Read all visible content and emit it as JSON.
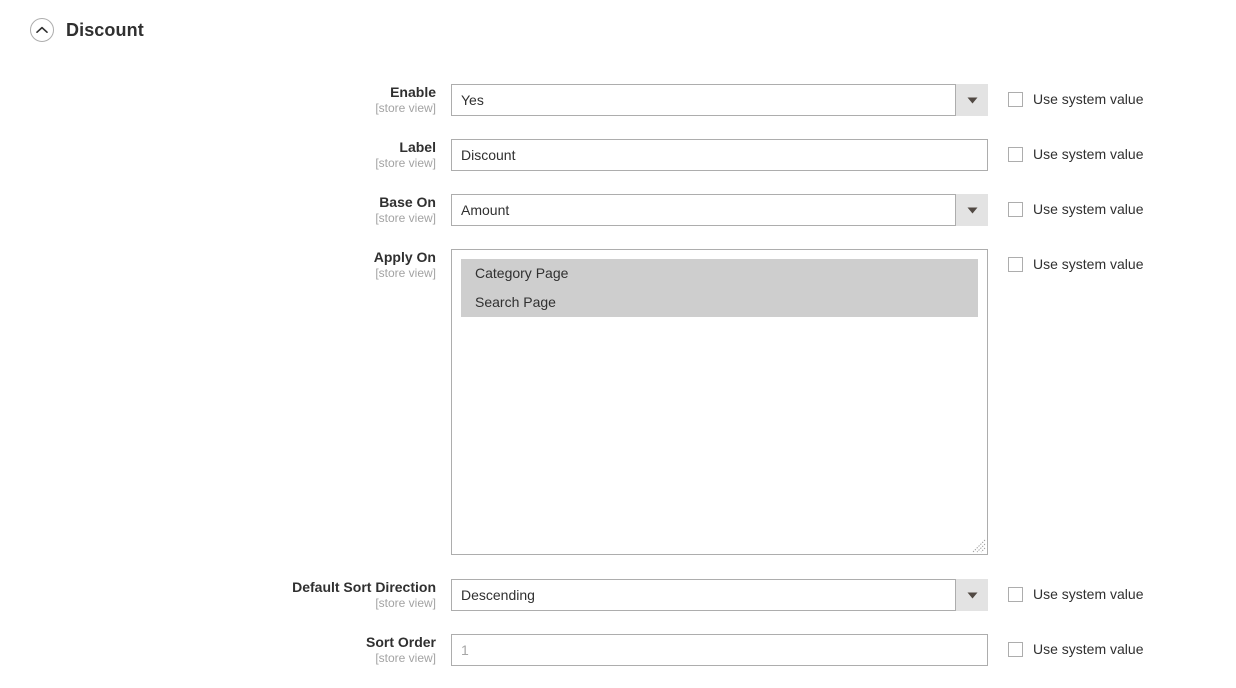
{
  "section": {
    "title": "Discount",
    "toggle_icon": "chevron-up-circle-icon",
    "expanded": true
  },
  "colors": {
    "page_background": "#ffffff",
    "text": "#303030",
    "scope_text": "#a3a3a3",
    "border": "#adadad",
    "select_button_background": "#e3e3e3",
    "multiselect_selected_background": "#cecece",
    "placeholder_text": "#a6a6a6"
  },
  "system_value": {
    "label": "Use system value",
    "checked": false
  },
  "fields": [
    {
      "name": "enable",
      "label": "Enable",
      "scope": "[store view]",
      "type": "select",
      "value": "Yes",
      "arrow_icon": "chevron-down-icon",
      "use_system_value": "Use system value"
    },
    {
      "name": "label",
      "label": "Label",
      "scope": "[store view]",
      "type": "text",
      "value": "Discount",
      "placeholder": "",
      "use_system_value": "Use system value"
    },
    {
      "name": "base_on",
      "label": "Base On",
      "scope": "[store view]",
      "type": "select",
      "value": "Amount",
      "arrow_icon": "chevron-down-icon",
      "use_system_value": "Use system value"
    },
    {
      "name": "apply_on",
      "label": "Apply On",
      "scope": "[store view]",
      "type": "multiselect",
      "options": [
        {
          "label": "Category Page",
          "selected": true
        },
        {
          "label": "Search Page",
          "selected": true
        }
      ],
      "use_system_value": "Use system value"
    },
    {
      "name": "default_sort_direction",
      "label": "Default Sort Direction",
      "scope": "[store view]",
      "type": "select",
      "value": "Descending",
      "arrow_icon": "chevron-down-icon",
      "use_system_value": "Use system value"
    },
    {
      "name": "sort_order",
      "label": "Sort Order",
      "scope": "[store view]",
      "type": "text",
      "value": "",
      "placeholder": "1",
      "use_system_value": "Use system value"
    }
  ]
}
